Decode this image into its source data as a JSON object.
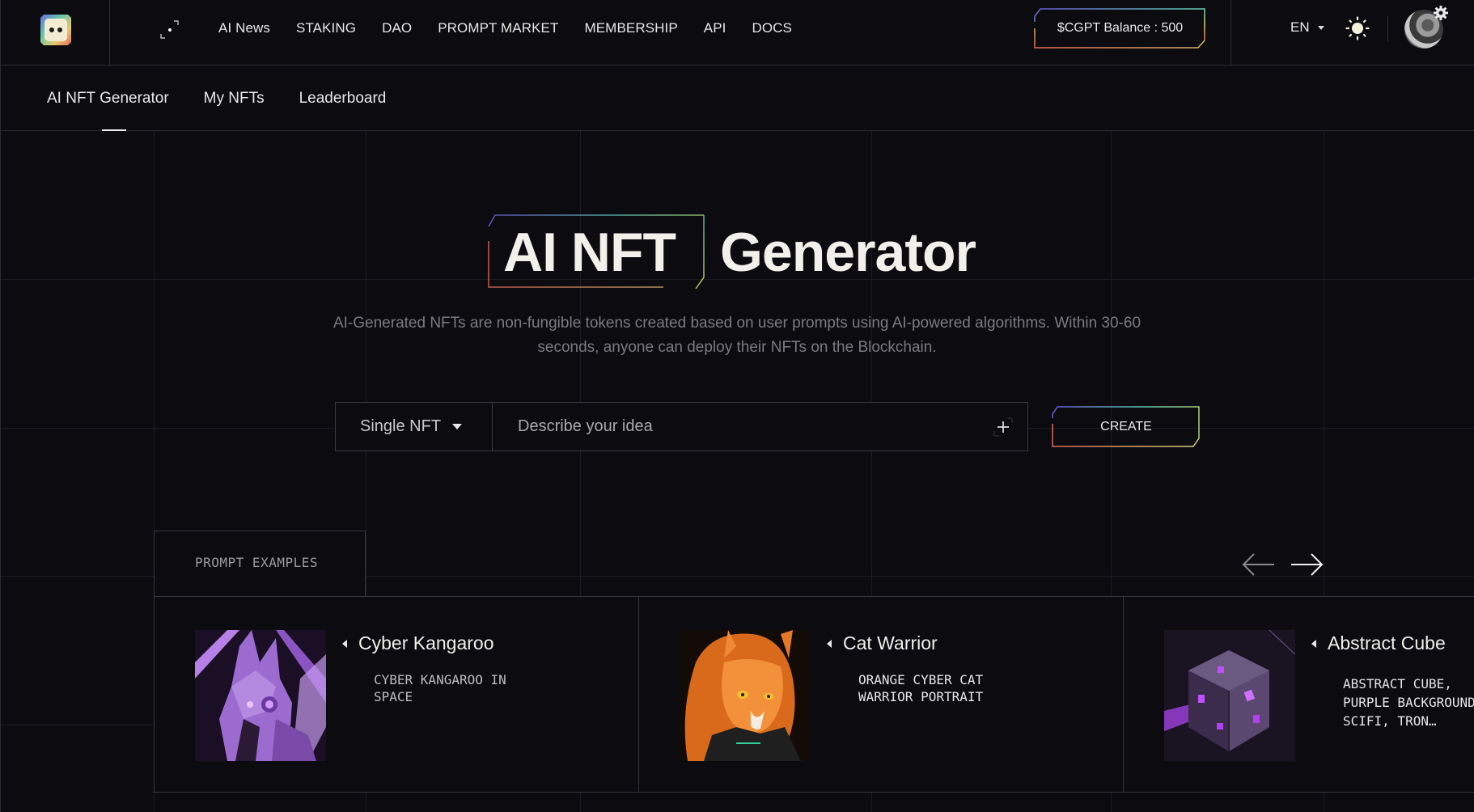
{
  "topbar": {
    "logo": "chaingpt-logo",
    "nav": [
      "AI News",
      "STAKING",
      "DAO",
      "PROMPT MARKET",
      "MEMBERSHIP",
      "API",
      "DOCS"
    ],
    "balance_label": "$CGPT Balance : 500",
    "language": "EN",
    "theme_icon": "sun-icon",
    "settings_icon": "gear-icon"
  },
  "subnav": {
    "tabs": [
      "AI NFT Generator",
      "My NFTs",
      "Leaderboard"
    ],
    "active_tab": "AI NFT Generator"
  },
  "hero": {
    "title_highlight": "AI NFT",
    "title_rest": "Generator",
    "description": "AI-Generated NFTs are non-fungible tokens created based on user prompts using AI-powered algorithms. Within 30-60 seconds, anyone can deploy their NFTs on the Blockchain."
  },
  "prompt": {
    "type_selected": "Single NFT",
    "placeholder": "Describe your idea",
    "value": "",
    "create_label": "CREATE"
  },
  "examples": {
    "label": "PROMPT EXAMPLES",
    "items": [
      {
        "title": "Cyber Kangaroo",
        "prompt": "CYBER KANGAROO IN SPACE",
        "image": "purple robotic kangaroo"
      },
      {
        "title": "Cat Warrior",
        "prompt": "ORANGE CYBER CAT WARRIOR PORTRAIT",
        "image": "orange cat warrior"
      },
      {
        "title": "Abstract Cube",
        "prompt": "ABSTRACT CUBE, PURPLE BACKGROUND, SCIFI, TRON…",
        "image": "glowing purple cube"
      }
    ]
  },
  "colors": {
    "background": "#0b0b10",
    "text": "#f1f0ea",
    "muted": "#7a7a80",
    "gradient": [
      "#6b5bd6",
      "#5fc7b7",
      "#d6d27a",
      "#e06a5a"
    ]
  }
}
